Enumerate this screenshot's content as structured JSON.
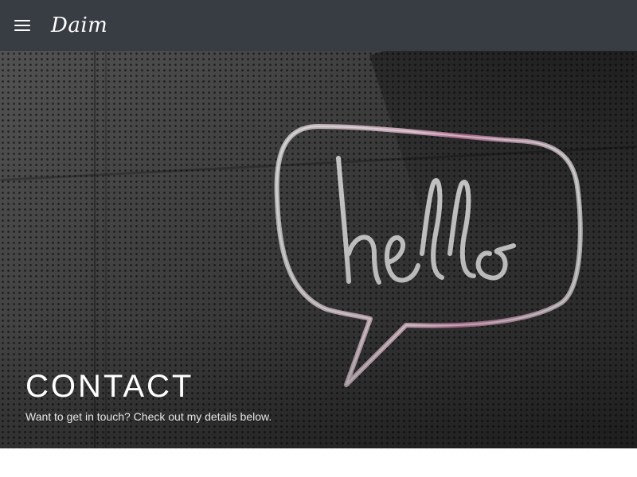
{
  "header": {
    "logo_text": "Daim",
    "menu_icon": "hamburger-menu-icon",
    "background_color": "#383c43"
  },
  "hero": {
    "image_description_icon": "neon-hello-sign",
    "title": "CONTACT",
    "subtitle": "Want to get in touch? Check out my details below."
  }
}
